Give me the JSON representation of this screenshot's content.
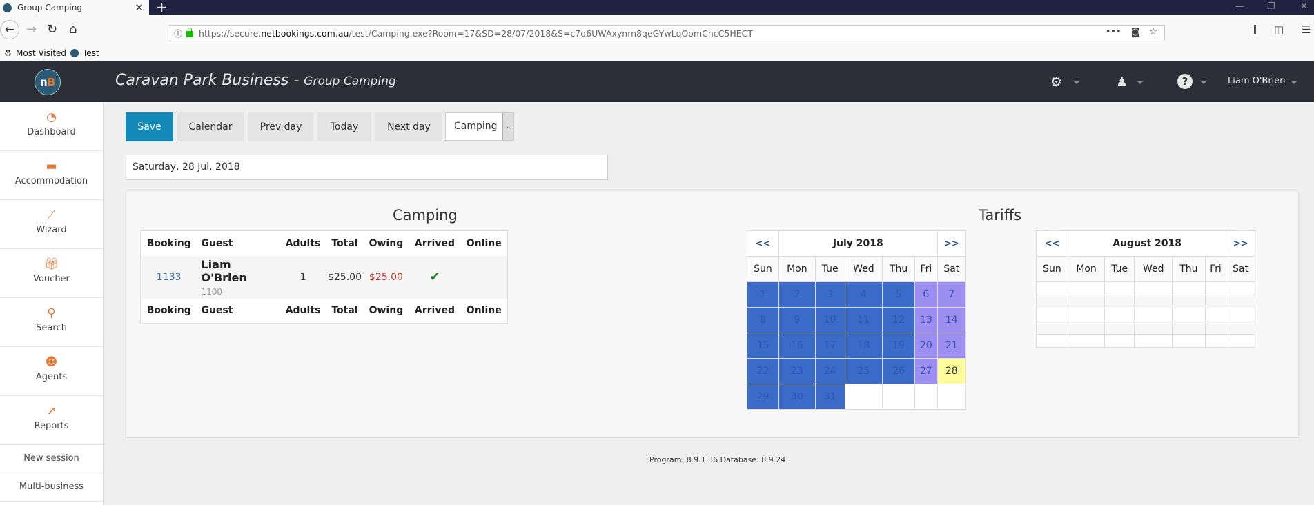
{
  "browser": {
    "tab_title": "Group Camping",
    "url_prefix": "https://secure.",
    "url_domain": "netbookings.com.au",
    "url_path": "/test/Camping.exe?Room=17&SD=28/07/2018&S=c7q6UWAxynrn8qeGYwLqOomChcC5HECT",
    "bookmarks": [
      "Most Visited",
      "Test"
    ]
  },
  "header": {
    "title": "Caravan Park Business",
    "separator": " - ",
    "subtitle": "Group Camping",
    "logo_text": "n",
    "logo_text2": "B",
    "user": "Liam O'Brien"
  },
  "sidebar": {
    "items": [
      {
        "label": "Dashboard",
        "icon": "dashboard-icon"
      },
      {
        "label": "Accommodation",
        "icon": "bed-icon"
      },
      {
        "label": "Wizard",
        "icon": "wand-icon"
      },
      {
        "label": "Voucher",
        "icon": "gift-icon"
      },
      {
        "label": "Search",
        "icon": "search-icon"
      },
      {
        "label": "Agents",
        "icon": "agent-icon"
      },
      {
        "label": "Reports",
        "icon": "chart-icon"
      }
    ],
    "links": [
      "New session",
      "Multi-business"
    ]
  },
  "toolbar": {
    "save": "Save",
    "calendar": "Calendar",
    "prev_day": "Prev day",
    "today": "Today",
    "next_day": "Next day",
    "select_value": "Camping"
  },
  "date_value": "Saturday, 28 Jul, 2018",
  "camping": {
    "title": "Camping",
    "columns": [
      "Booking",
      "Guest",
      "Adults",
      "Total",
      "Owing",
      "Arrived",
      "Online"
    ],
    "rows": [
      {
        "booking": "1133",
        "guest": "Liam O'Brien",
        "guest_sub": "1100",
        "adults": "1",
        "total": "$25.00",
        "owing": "$25.00",
        "arrived": true,
        "online": ""
      }
    ]
  },
  "tariffs": {
    "title": "Tariffs",
    "prev": "<<",
    "next": ">>",
    "weekdays": [
      "Sun",
      "Mon",
      "Tue",
      "Wed",
      "Thu",
      "Fri",
      "Sat"
    ],
    "july": {
      "label": "July 2018",
      "start_weekday": 0,
      "days": 31,
      "selected": 28,
      "weekend_days": [
        6,
        7,
        13,
        14,
        20,
        21,
        27
      ]
    },
    "august": {
      "label": "August 2018",
      "rows": 5
    }
  },
  "colors": {
    "primary": "#1389b8",
    "day": "#3a6bc8",
    "weekend": "#9d8ff2",
    "selected": "#fdfd9c",
    "owing": "#c0392b"
  },
  "footer": "Program: 8.9.1.36 Database: 8.9.24"
}
